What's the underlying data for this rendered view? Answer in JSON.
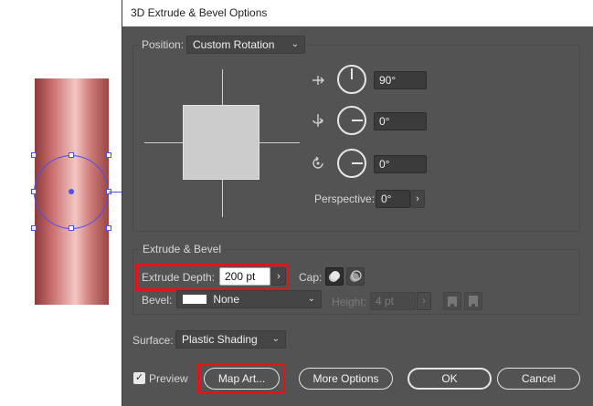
{
  "dialog": {
    "title": "3D Extrude & Bevel Options"
  },
  "position": {
    "label": "Position:",
    "value": "Custom Rotation",
    "x_angle": "90°",
    "y_angle": "0°",
    "z_angle": "0°",
    "perspective_label": "Perspective:",
    "perspective_value": "0°"
  },
  "extrude": {
    "section_label": "Extrude & Bevel",
    "depth_label": "Extrude Depth:",
    "depth_value": "200 pt",
    "cap_label": "Cap:",
    "bevel_label": "Bevel:",
    "bevel_value": "None",
    "height_label": "Height:",
    "height_value": "4 pt"
  },
  "surface": {
    "label": "Surface:",
    "value": "Plastic Shading"
  },
  "footer": {
    "preview_label": "Preview",
    "preview_checked": "✓",
    "map_art": "Map Art...",
    "more_options": "More Options",
    "ok": "OK",
    "cancel": "Cancel"
  },
  "icons": {
    "chevron": "⌄",
    "stepper_arrow": "›",
    "rotate_x": "⊕",
    "rotate_y": "⊕",
    "rotate_z": "↺"
  },
  "colors": {
    "dialog_bg": "#535353",
    "highlight": "#e0151b",
    "selection": "#4a4ff0"
  }
}
